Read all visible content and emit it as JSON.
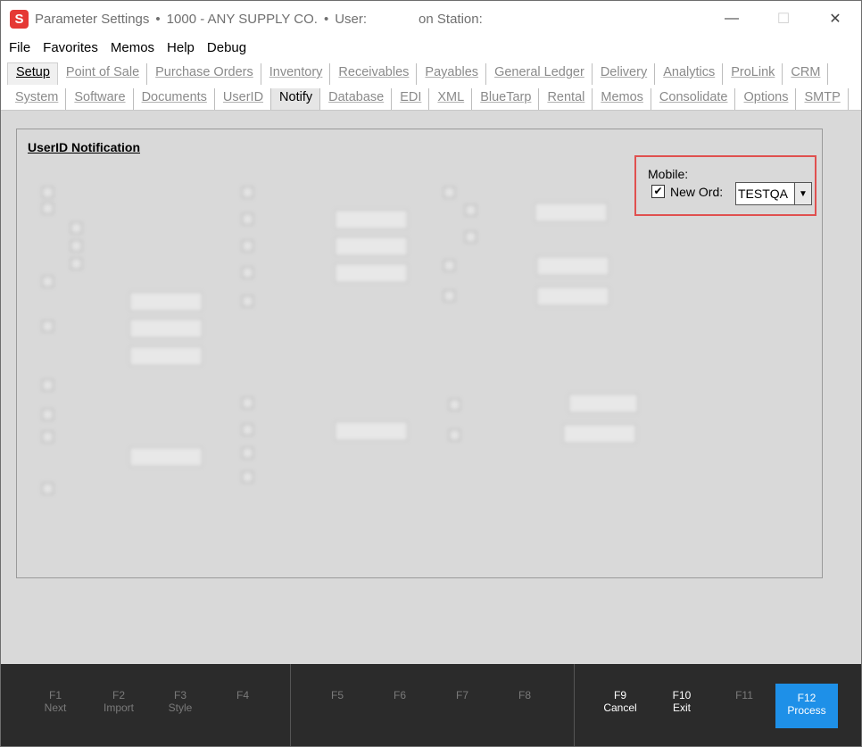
{
  "window": {
    "title": "Parameter Settings",
    "separator": "•",
    "company": "1000 - ANY SUPPLY CO.",
    "user_label": "User:",
    "station_label": "on Station:",
    "app_icon_letter": "S",
    "minimize": "—",
    "maximize": "☐",
    "close": "✕"
  },
  "menu": [
    "File",
    "Favorites",
    "Memos",
    "Help",
    "Debug"
  ],
  "main_tabs": [
    "Setup",
    "Point of Sale",
    "Purchase Orders",
    "Inventory",
    "Receivables",
    "Payables",
    "General Ledger",
    "Delivery",
    "Analytics",
    "ProLink",
    "CRM"
  ],
  "sub_tabs": [
    "System",
    "Software",
    "Documents",
    "UserID",
    "Notify",
    "Database",
    "EDI",
    "XML",
    "BlueTarp",
    "Rental",
    "Memos",
    "Consolidate",
    "Options",
    "SMTP"
  ],
  "group": {
    "title": "UserID Notification"
  },
  "mobile": {
    "label": "Mobile:",
    "checkbox_mark": "✔",
    "new_ord_label": "New Ord:",
    "new_ord_value": "TESTQA",
    "dropdown_icon": "▼"
  },
  "fkeys": [
    {
      "key": "F1",
      "label": "Next"
    },
    {
      "key": "F2",
      "label": "Import"
    },
    {
      "key": "F3",
      "label": "Style"
    },
    {
      "key": "F4",
      "label": ""
    },
    {
      "key": "F5",
      "label": ""
    },
    {
      "key": "F6",
      "label": ""
    },
    {
      "key": "F7",
      "label": ""
    },
    {
      "key": "F8",
      "label": ""
    },
    {
      "key": "F9",
      "label": "Cancel"
    },
    {
      "key": "F10",
      "label": "Exit"
    },
    {
      "key": "F11",
      "label": ""
    },
    {
      "key": "F12",
      "label": "Process"
    }
  ],
  "colors": {
    "highlight_border": "#e0504f",
    "process_button": "#1e90e8",
    "bottombar": "#2b2b2b"
  }
}
